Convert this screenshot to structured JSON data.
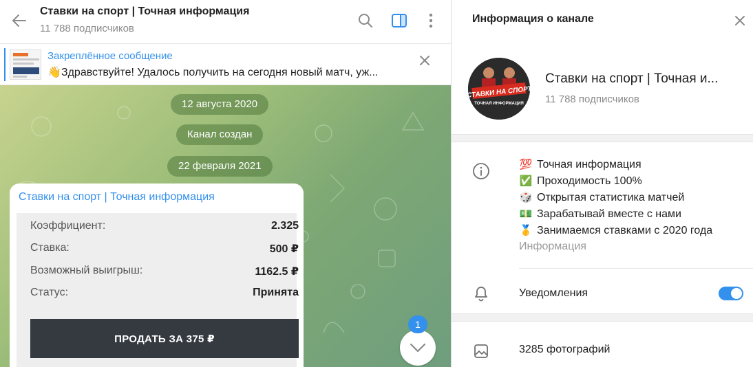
{
  "header": {
    "title": "Ставки на спорт | Точная информация",
    "subscribers": "11 788 подписчиков"
  },
  "pinned": {
    "title": "Закреплённое сообщение",
    "text": "Здравствуйте! Удалось получить на сегодня новый матч, уж..."
  },
  "dates": [
    "12 августа 2020",
    "Канал создан",
    "22 февраля 2021"
  ],
  "message": {
    "channel": "Ставки на спорт | Точная информация",
    "rows": [
      {
        "label": "Коэффициент:",
        "value": "2.325"
      },
      {
        "label": "Ставка:",
        "value": "500 ₽"
      },
      {
        "label": "Возможный выигрыш:",
        "value": "1162.5 ₽"
      },
      {
        "label": "Статус:",
        "value": "Принята"
      }
    ],
    "button": "ПРОДАТЬ ЗА 375 ₽"
  },
  "unread_count": "1",
  "info": {
    "title": "Информация о канале",
    "channel_name": "Ставки на спорт | Точная и...",
    "subscribers": "11 788 подписчиков",
    "description": [
      {
        "emoji": "💯",
        "text": "Точная информация"
      },
      {
        "emoji": "✅",
        "text": "Проходимость 100%"
      },
      {
        "emoji": "🎲",
        "text": "Открытая статистика матчей"
      },
      {
        "emoji": "💵",
        "text": "Зарабатывай вместе с нами"
      },
      {
        "emoji": "🥇",
        "text": "Занимаемся ставками с 2020 года"
      }
    ],
    "description_label": "Информация",
    "notifications_label": "Уведомления",
    "notifications_on": true,
    "photos_label": "3285 фотографий"
  },
  "colors": {
    "accent": "#3390ec",
    "button_dark": "#343a40",
    "date_pill": "rgba(80,120,60,0.55)"
  }
}
